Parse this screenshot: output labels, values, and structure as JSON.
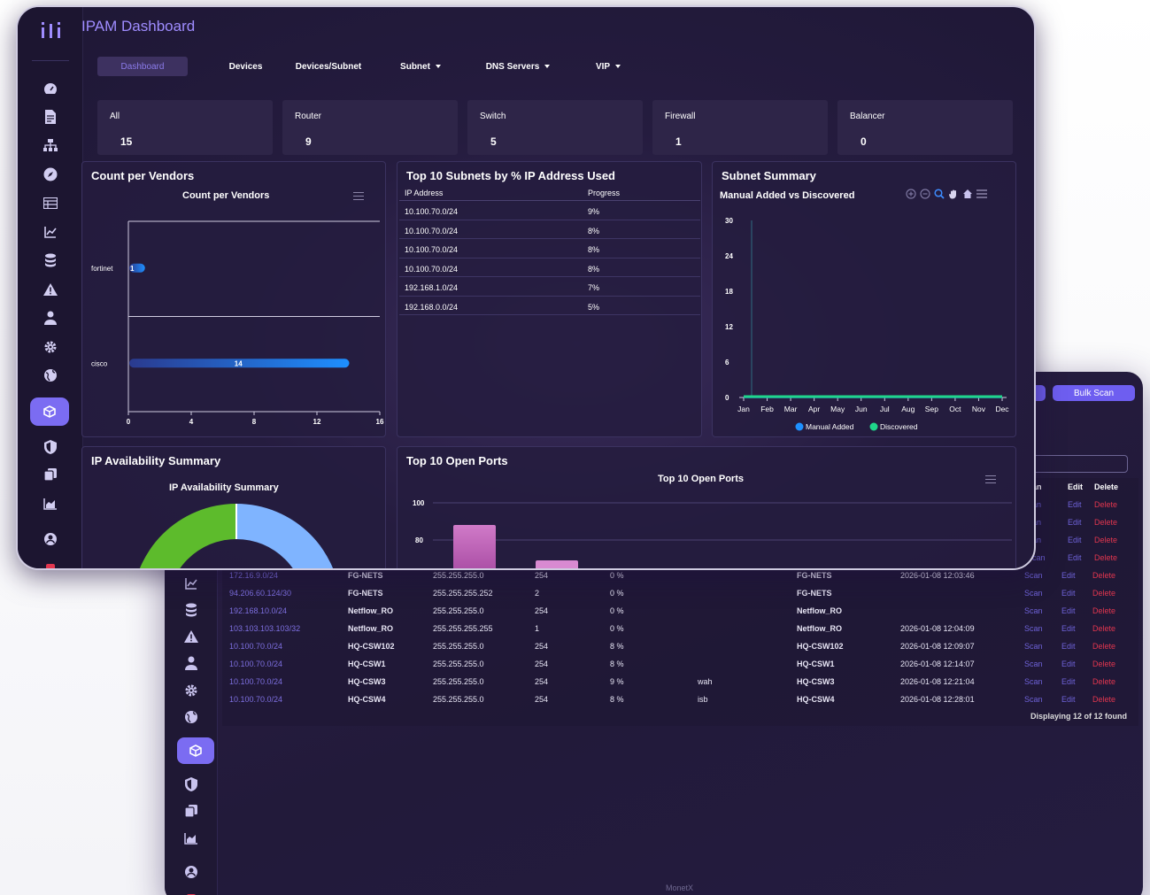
{
  "app": {
    "title": "IPAM Dashboard",
    "footer": "MonetX"
  },
  "nav": [
    {
      "label": "Dashboard",
      "active": true,
      "dropdown": false
    },
    {
      "label": "Devices",
      "active": false,
      "dropdown": false
    },
    {
      "label": "Devices/Subnet",
      "active": false,
      "dropdown": false
    },
    {
      "label": "Subnet",
      "active": false,
      "dropdown": true
    },
    {
      "label": "DNS Servers",
      "active": false,
      "dropdown": true
    },
    {
      "label": "VIP",
      "active": false,
      "dropdown": true
    }
  ],
  "stats": [
    {
      "label": "All",
      "value": "15"
    },
    {
      "label": "Router",
      "value": "9"
    },
    {
      "label": "Switch",
      "value": "5"
    },
    {
      "label": "Firewall",
      "value": "1"
    },
    {
      "label": "Balancer",
      "value": "0"
    }
  ],
  "sidebar_icons": [
    "dashboard-icon",
    "document-icon",
    "sitemap-icon",
    "compass-icon",
    "table-icon",
    "line-chart-icon",
    "database-icon",
    "warning-icon",
    "user-icon",
    "gear-icon",
    "globe-icon",
    "cube-icon",
    "shield-icon",
    "copy-icon",
    "area-chart-icon",
    "account-circle-icon"
  ],
  "panels": {
    "vendors": {
      "title": "Count per Vendors",
      "chart_title": "Count per Vendors"
    },
    "subnets": {
      "title": "Top 10 Subnets by % IP Address Used",
      "col_ip": "IP Address",
      "col_progress": "Progress"
    },
    "summary": {
      "title": "Subnet Summary",
      "chart_title": "Manual Added vs Discovered"
    },
    "availability": {
      "title": "IP Availability Summary",
      "chart_title": "IP Availability Summary"
    },
    "ports": {
      "title": "Top 10 Open Ports",
      "chart_title": "Top 10 Open Ports"
    }
  },
  "subnet_rows": [
    {
      "ip": "10.100.70.0/24",
      "progress": "9%"
    },
    {
      "ip": "10.100.70.0/24",
      "progress": "8%"
    },
    {
      "ip": "10.100.70.0/24",
      "progress": "8%"
    },
    {
      "ip": "10.100.70.0/24",
      "progress": "8%"
    },
    {
      "ip": "192.168.1.0/24",
      "progress": "7%"
    },
    {
      "ip": "192.168.0.0/24",
      "progress": "5%"
    }
  ],
  "chart_data": [
    {
      "type": "bar",
      "orientation": "horizontal",
      "title": "Count per Vendors",
      "categories": [
        "fortinet",
        "cisco"
      ],
      "values": [
        1,
        14
      ],
      "xlim": [
        0,
        16
      ],
      "xticks": [
        0,
        4,
        8,
        12,
        16
      ],
      "colors": {
        "bar_start": "#2a3a8f",
        "bar_end": "#1e8fff"
      }
    },
    {
      "type": "line",
      "title": "Manual Added vs Discovered",
      "categories": [
        "Jan",
        "Feb",
        "Mar",
        "Apr",
        "May",
        "Jun",
        "Jul",
        "Aug",
        "Sep",
        "Oct",
        "Nov",
        "Dec"
      ],
      "series": [
        {
          "name": "Manual Added",
          "values": [
            0,
            0,
            0,
            0,
            0,
            0,
            0,
            0,
            0,
            0,
            0,
            0
          ],
          "color": "#1e90ff"
        },
        {
          "name": "Discovered",
          "values": [
            0,
            0,
            0,
            0,
            0,
            0,
            0,
            0,
            0,
            0,
            0,
            0
          ],
          "color": "#1fd68a"
        }
      ],
      "ylim": [
        0,
        30
      ],
      "yticks": [
        0,
        6,
        12,
        18,
        24,
        30
      ],
      "legend": "bottom"
    },
    {
      "type": "pie",
      "title": "IP Availability Summary",
      "colors": [
        "#7fb4ff",
        "#5dbb2c"
      ]
    },
    {
      "type": "bar",
      "title": "Top 10 Open Ports",
      "ylim_visible": [
        75,
        100
      ],
      "yticks_visible": [
        80,
        100
      ],
      "colors": [
        "#c45bb5",
        "#d88ad1"
      ]
    }
  ],
  "back_window": {
    "bulk_scan_label": "Bulk Scan",
    "headers": {
      "scan": "an",
      "edit": "Edit",
      "delete": "Delete"
    },
    "partial_rows": [
      {
        "scan": "an"
      },
      {
        "scan": "an"
      },
      {
        "scan": "an"
      },
      {
        "scan": "can"
      }
    ],
    "rows": [
      {
        "network": "172.16.9.0/24",
        "device": "FG-NETS",
        "mask": "255.255.255.0",
        "hosts": "254",
        "pct": "0 %",
        "desc": "",
        "device2": "FG-NETS",
        "time": "2026-01-08 12:03:46"
      },
      {
        "network": "94.206.60.124/30",
        "device": "FG-NETS",
        "mask": "255.255.255.252",
        "hosts": "2",
        "pct": "0 %",
        "desc": "",
        "device2": "FG-NETS",
        "time": ""
      },
      {
        "network": "192.168.10.0/24",
        "device": "Netflow_RO",
        "mask": "255.255.255.0",
        "hosts": "254",
        "pct": "0 %",
        "desc": "",
        "device2": "Netflow_RO",
        "time": ""
      },
      {
        "network": "103.103.103.103/32",
        "device": "Netflow_RO",
        "mask": "255.255.255.255",
        "hosts": "1",
        "pct": "0 %",
        "desc": "",
        "device2": "Netflow_RO",
        "time": "2026-01-08 12:04:09"
      },
      {
        "network": "10.100.70.0/24",
        "device": "HQ-CSW102",
        "mask": "255.255.255.0",
        "hosts": "254",
        "pct": "8 %",
        "desc": "",
        "device2": "HQ-CSW102",
        "time": "2026-01-08 12:09:07"
      },
      {
        "network": "10.100.70.0/24",
        "device": "HQ-CSW1",
        "mask": "255.255.255.0",
        "hosts": "254",
        "pct": "8 %",
        "desc": "",
        "device2": "HQ-CSW1",
        "time": "2026-01-08 12:14:07"
      },
      {
        "network": "10.100.70.0/24",
        "device": "HQ-CSW3",
        "mask": "255.255.255.0",
        "hosts": "254",
        "pct": "9 %",
        "desc": "wah",
        "device2": "HQ-CSW3",
        "time": "2026-01-08 12:21:04"
      },
      {
        "network": "10.100.70.0/24",
        "device": "HQ-CSW4",
        "mask": "255.255.255.0",
        "hosts": "254",
        "pct": "8 %",
        "desc": "isb",
        "device2": "HQ-CSW4",
        "time": "2026-01-08 12:28:01"
      }
    ],
    "actions": {
      "scan": "Scan",
      "edit": "Edit",
      "delete": "Delete"
    },
    "footer_count": "Displaying 12 of 12 found"
  }
}
